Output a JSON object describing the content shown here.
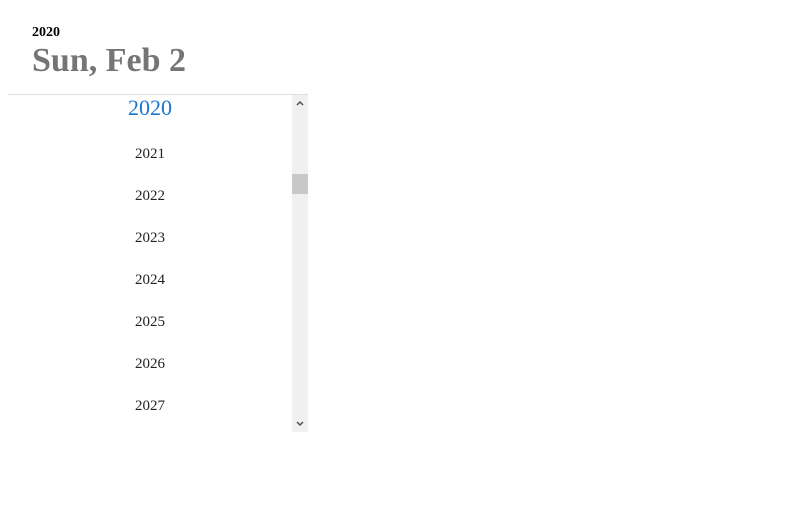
{
  "header": {
    "year": "2020",
    "date": "Sun, Feb 2"
  },
  "year_list": {
    "selected": "2020",
    "years": [
      "2021",
      "2022",
      "2023",
      "2024",
      "2025",
      "2026",
      "2027"
    ]
  },
  "scrollbar": {
    "up_icon": "chevron-up-icon",
    "down_icon": "chevron-down-icon"
  },
  "colors": {
    "accent": "#1976d2",
    "header_date": "#757575"
  }
}
